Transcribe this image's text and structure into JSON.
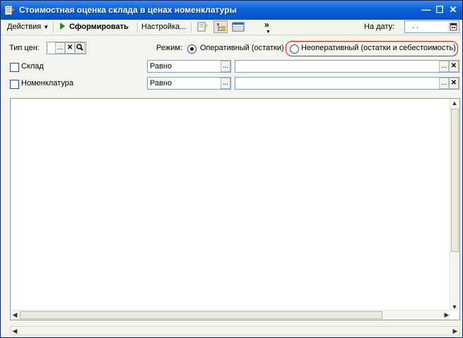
{
  "window": {
    "title": "Стоимостная оценка склада в ценах номенклатуры",
    "minimize_glyph": "—",
    "maximize_glyph": "☐",
    "close_glyph": "✕"
  },
  "toolbar": {
    "actions_label": "Действия",
    "generate_label": "Сформировать",
    "settings_label": "Настройка...",
    "more_glyph": "»",
    "date_label": "На дату:",
    "date_value": ". ."
  },
  "filters": {
    "price_type_label": "Тип цен:",
    "price_type_value": "",
    "mode_label": "Режим:",
    "mode_operational_label": "Оперативный (остатки)",
    "mode_nonoperational_label": "Неоперативный (остатки и себестоимость)",
    "mode_selected": "operational",
    "warehouse": {
      "label": "Склад",
      "checked": false,
      "comparison": "Равно",
      "value": ""
    },
    "nomenclature": {
      "label": "Номенклатура",
      "checked": false,
      "comparison": "Равно",
      "value": ""
    }
  },
  "buttons": {
    "ellipsis": "...",
    "clear": "✕",
    "search": "🔍"
  },
  "colors": {
    "titlebar": "#0b5fd8",
    "highlight": "#d81a1a",
    "generate_icon": "#1a8c1a"
  }
}
